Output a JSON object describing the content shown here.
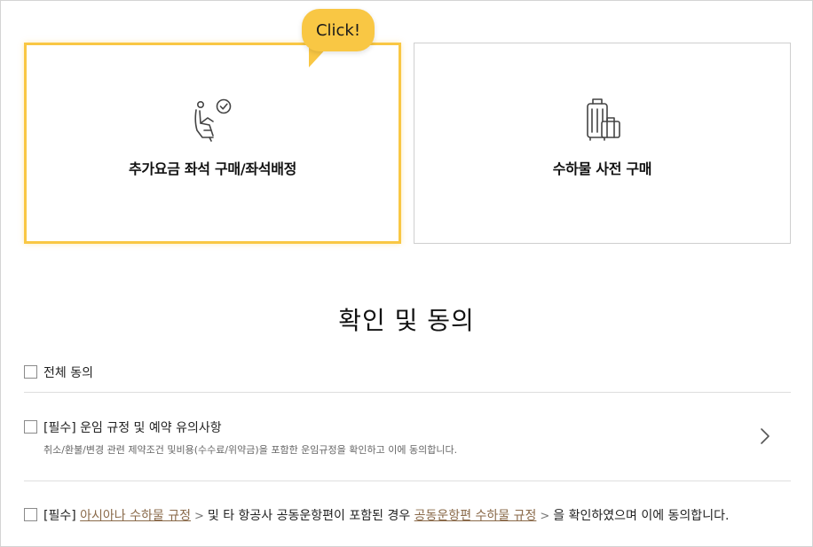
{
  "tooltip": {
    "text": "Click!",
    "color": "#f9c744"
  },
  "cards": [
    {
      "label": "추가요금 좌석 구매/좌석배정",
      "icon": "seat-check-icon",
      "selected": true
    },
    {
      "label": "수하물 사전 구매",
      "icon": "luggage-icon",
      "selected": false
    }
  ],
  "agreement": {
    "title": "확인 및 동의",
    "all_label": "전체 동의",
    "item1": {
      "label": "[필수] 운임 규정 및 예약 유의사항",
      "description": "취소/환불/변경 관련 제약조건 및비용(수수료/위약금)을 포함한 운임규정을 확인하고 이에 동의합니다."
    },
    "item2": {
      "prefix": "[필수]",
      "link1": "아시아나 수하물 규정",
      "middle": "및 타 항공사 공동운항편이 포함된 경우",
      "link2": "공동운항편 수하물 규정",
      "suffix": "을 확인하였으며 이에 동의합니다.",
      "gt": ">"
    }
  },
  "colors": {
    "accent": "#f9c744",
    "link": "#8a6a4a"
  }
}
